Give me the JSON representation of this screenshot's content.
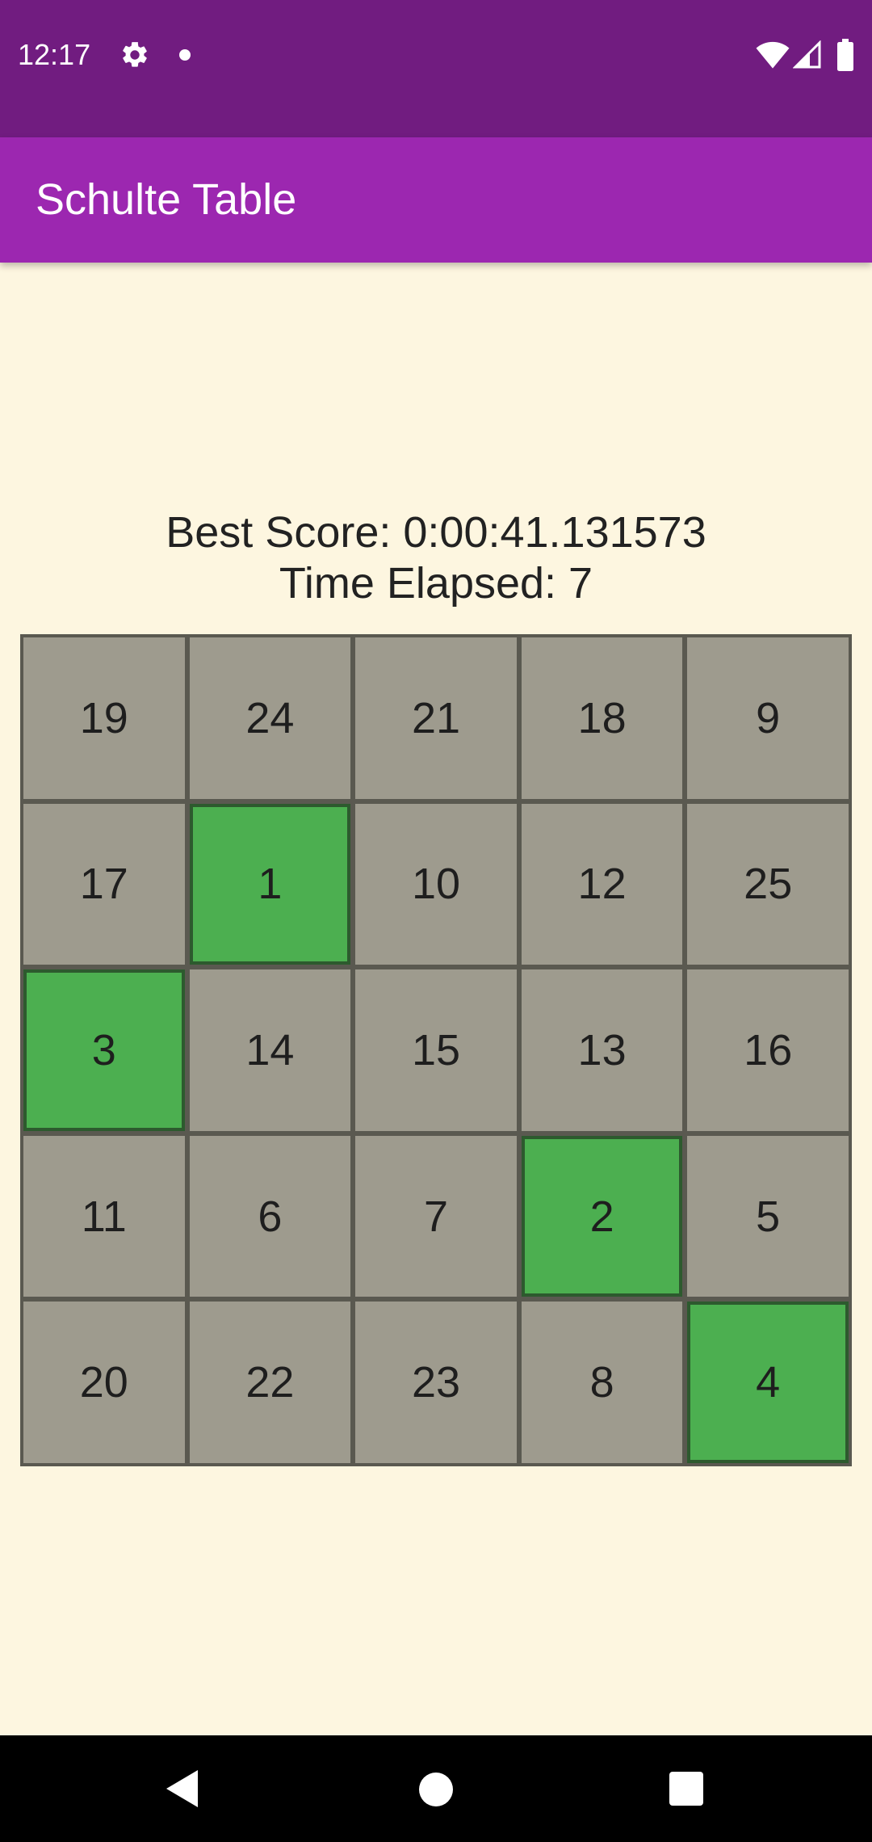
{
  "status_bar": {
    "time": "12:17",
    "icons": [
      "gear-icon",
      "notification-dot-icon",
      "wifi-icon",
      "signal-icon",
      "battery-icon"
    ]
  },
  "app_bar": {
    "title": "Schulte Table",
    "color": "#9C27B0"
  },
  "score": {
    "best_score": "Best Score: 0:00:41.131573",
    "time_elapsed": "Time Elapsed: 7"
  },
  "grid": {
    "colors": {
      "cell": "#9E9B8E",
      "found": "#4CAF50",
      "border": "#5A5950"
    },
    "cells": [
      {
        "n": "19",
        "found": false
      },
      {
        "n": "24",
        "found": false
      },
      {
        "n": "21",
        "found": false
      },
      {
        "n": "18",
        "found": false
      },
      {
        "n": "9",
        "found": false
      },
      {
        "n": "17",
        "found": false
      },
      {
        "n": "1",
        "found": true
      },
      {
        "n": "10",
        "found": false
      },
      {
        "n": "12",
        "found": false
      },
      {
        "n": "25",
        "found": false
      },
      {
        "n": "3",
        "found": true
      },
      {
        "n": "14",
        "found": false
      },
      {
        "n": "15",
        "found": false
      },
      {
        "n": "13",
        "found": false
      },
      {
        "n": "16",
        "found": false
      },
      {
        "n": "11",
        "found": false
      },
      {
        "n": "6",
        "found": false
      },
      {
        "n": "7",
        "found": false
      },
      {
        "n": "2",
        "found": true
      },
      {
        "n": "5",
        "found": false
      },
      {
        "n": "20",
        "found": false
      },
      {
        "n": "22",
        "found": false
      },
      {
        "n": "23",
        "found": false
      },
      {
        "n": "8",
        "found": false
      },
      {
        "n": "4",
        "found": true
      }
    ]
  },
  "nav_bar": {
    "icons": [
      "back-icon",
      "home-icon",
      "recents-icon"
    ]
  }
}
